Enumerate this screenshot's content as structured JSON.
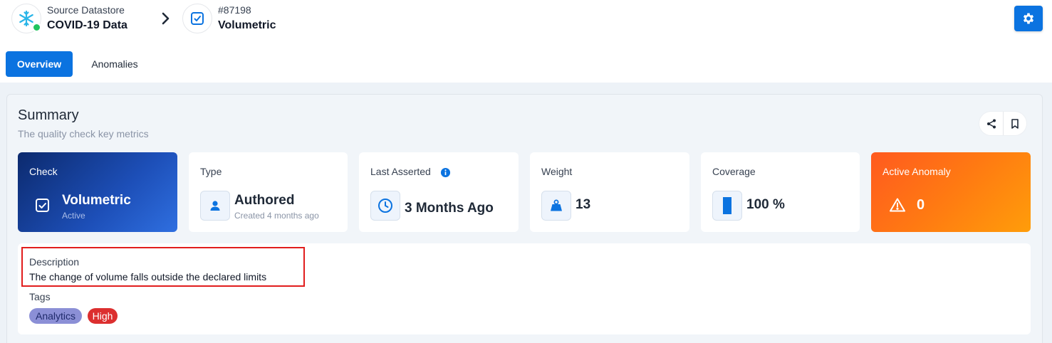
{
  "header": {
    "datastore": {
      "label": "Source Datastore",
      "name": "COVID-19 Data",
      "icon": "snowflake-icon",
      "status_color": "#22c55e"
    },
    "check": {
      "id": "#87198",
      "name": "Volumetric",
      "icon": "check-square-icon"
    },
    "settings_icon": "gear-icon"
  },
  "tabs": [
    {
      "label": "Overview",
      "active": true
    },
    {
      "label": "Anomalies",
      "active": false
    }
  ],
  "summary": {
    "title": "Summary",
    "subtitle": "The quality check key metrics",
    "actions": [
      "share-icon",
      "bookmark-icon"
    ],
    "cards": {
      "check": {
        "label": "Check",
        "value": "Volumetric",
        "sub": "Active",
        "icon": "check-square-icon"
      },
      "type": {
        "label": "Type",
        "value": "Authored",
        "sub": "Created 4 months ago",
        "icon": "user-icon"
      },
      "last_asserted": {
        "label": "Last Asserted",
        "value": "3 Months Ago",
        "icon": "clock-icon",
        "info_icon": "info-icon"
      },
      "weight": {
        "label": "Weight",
        "value": "13",
        "icon": "weight-icon"
      },
      "coverage": {
        "label": "Coverage",
        "value": "100 %",
        "fill_fraction": 1.0,
        "icon": "coverage-bar-icon"
      },
      "active_anomaly": {
        "label": "Active Anomaly",
        "value": "0",
        "icon": "warning-icon"
      }
    }
  },
  "details": {
    "description_label": "Description",
    "description": "The change of volume falls outside the declared limits",
    "tags_label": "Tags",
    "tags": [
      {
        "label": "Analytics",
        "bg": "#8b8fd6",
        "color": "#1f2a6b"
      },
      {
        "label": "High",
        "bg": "#dc2f2f",
        "color": "#ffffff"
      }
    ]
  },
  "colors": {
    "accent": "#0b73e0",
    "highlight": "#e11d1d"
  }
}
